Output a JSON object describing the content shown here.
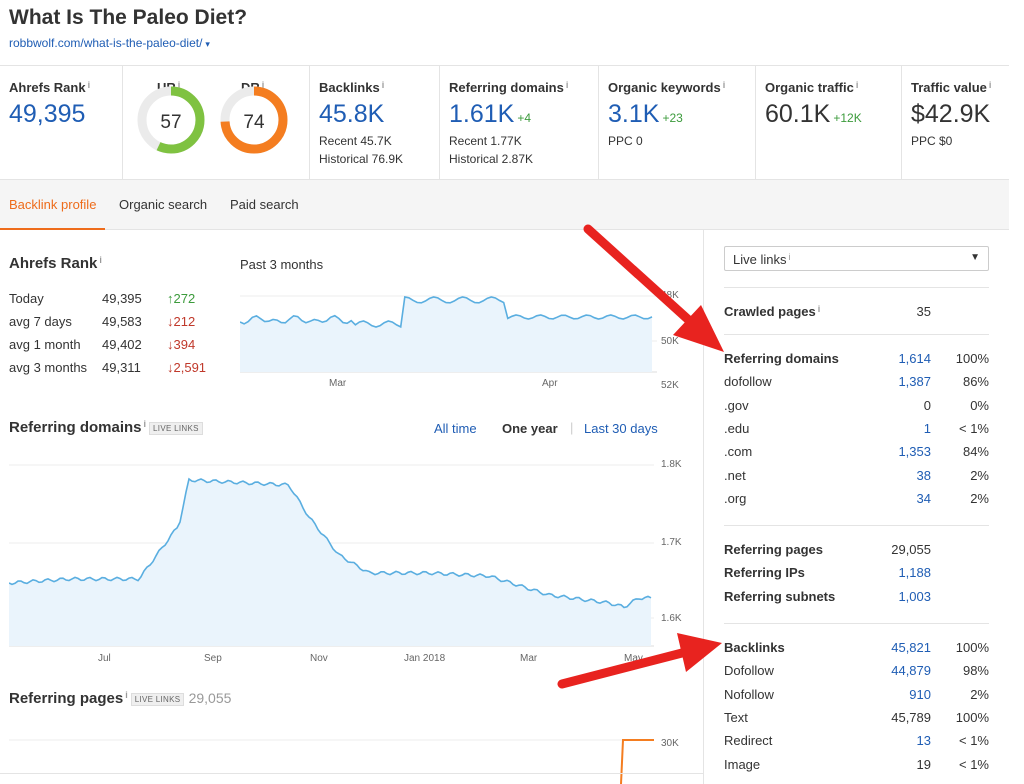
{
  "header": {
    "title": "What Is The Paleo Diet?",
    "url": "robbwolf.com/what-is-the-paleo-diet/",
    "url_caret": "▾"
  },
  "metrics": {
    "ahrefs_rank": {
      "label": "Ahrefs Rank",
      "info": "i",
      "value": "49,395"
    },
    "ur": {
      "label": "UR",
      "info": "i",
      "value": "57",
      "level": 0.57,
      "color": "#7fc241"
    },
    "dr": {
      "label": "DR",
      "info": "i",
      "value": "74",
      "level": 0.74,
      "color": "#f47d20"
    },
    "backlinks": {
      "label": "Backlinks",
      "info": "i",
      "value": "45.8K",
      "recent": "Recent 45.7K",
      "historical": "Historical 76.9K"
    },
    "referring_domains": {
      "label": "Referring domains",
      "info": "i",
      "value": "1.61K",
      "delta": "+4",
      "recent": "Recent 1.77K",
      "historical": "Historical 2.87K"
    },
    "organic_keywords": {
      "label": "Organic keywords",
      "info": "i",
      "value": "3.1K",
      "delta": "+23",
      "ppc": "PPC 0"
    },
    "organic_traffic": {
      "label": "Organic traffic",
      "info": "i",
      "value": "60.1K",
      "delta": "+12K"
    },
    "traffic_value": {
      "label": "Traffic value",
      "info": "i",
      "value": "$42.9K",
      "ppc": "PPC $0"
    }
  },
  "tabs": [
    {
      "label": "Backlink profile",
      "active": true
    },
    {
      "label": "Organic search",
      "active": false
    },
    {
      "label": "Paid search",
      "active": false
    }
  ],
  "ahrefs_rank_section": {
    "title": "Ahrefs Rank",
    "info": "i",
    "period_label": "Past 3 months",
    "rows": [
      {
        "label": "Today",
        "value": "49,395",
        "delta": "↑272",
        "dir": "up"
      },
      {
        "label": "avg 7 days",
        "value": "49,583",
        "delta": "↓212",
        "dir": "down"
      },
      {
        "label": "avg 1 month",
        "value": "49,402",
        "delta": "↓394",
        "dir": "down"
      },
      {
        "label": "avg 3 months",
        "value": "49,311",
        "delta": "↓2,591",
        "dir": "down"
      }
    ],
    "chart": {
      "y_ticks": [
        "48K",
        "50K",
        "52K"
      ],
      "x_ticks": [
        "Mar",
        "Apr"
      ],
      "line_color": "#5aaee0",
      "fill_color": "#eaf4fc"
    }
  },
  "referring_domains_section": {
    "title": "Referring domains",
    "info": "i",
    "badge": "LIVE LINKS",
    "ranges": [
      {
        "label": "All time",
        "selected": false
      },
      {
        "label": "One year",
        "selected": true
      },
      {
        "label": "Last 30 days",
        "selected": false
      }
    ],
    "range_separator": "|",
    "chart": {
      "y_ticks": [
        "1.8K",
        "1.7K",
        "1.6K"
      ],
      "x_ticks": [
        "Jul",
        "Sep",
        "Nov",
        "Jan 2018",
        "Mar",
        "May"
      ],
      "line_color": "#5aaee0",
      "fill_color": "#eaf4fc"
    }
  },
  "referring_pages_section": {
    "title": "Referring pages",
    "info": "i",
    "badge": "LIVE LINKS",
    "value": "29,055",
    "y_tick": "30K",
    "line_color": "#f47d20"
  },
  "right_panel": {
    "select_label": "Live links",
    "select_info": "i",
    "select_arrow": "▼",
    "crawled": {
      "label": "Crawled pages",
      "info": "i",
      "value": "35"
    },
    "domains": [
      {
        "label": "Referring domains",
        "value": "1,614",
        "pct": "100%",
        "bold": true,
        "blue": true
      },
      {
        "label": "dofollow",
        "value": "1,387",
        "pct": "86%",
        "bold": false,
        "blue": true
      },
      {
        "label": ".gov",
        "value": "0",
        "pct": "0%",
        "bold": false,
        "blue": false
      },
      {
        "label": ".edu",
        "value": "1",
        "pct": "< 1%",
        "bold": false,
        "blue": true
      },
      {
        "label": ".com",
        "value": "1,353",
        "pct": "84%",
        "bold": false,
        "blue": true
      },
      {
        "label": ".net",
        "value": "38",
        "pct": "2%",
        "bold": false,
        "blue": true
      },
      {
        "label": ".org",
        "value": "34",
        "pct": "2%",
        "bold": false,
        "blue": true
      }
    ],
    "refs": [
      {
        "label": "Referring pages",
        "value": "29,055",
        "blue": false
      },
      {
        "label": "Referring IPs",
        "value": "1,188",
        "blue": true
      },
      {
        "label": "Referring subnets",
        "value": "1,003",
        "blue": true
      }
    ],
    "backlinks": [
      {
        "label": "Backlinks",
        "value": "45,821",
        "pct": "100%",
        "bold": true,
        "blue": true
      },
      {
        "label": "Dofollow",
        "value": "44,879",
        "pct": "98%",
        "bold": false,
        "blue": true
      },
      {
        "label": "Nofollow",
        "value": "910",
        "pct": "2%",
        "bold": false,
        "blue": true
      },
      {
        "label": "Text",
        "value": "45,789",
        "pct": "100%",
        "bold": false,
        "blue": false
      },
      {
        "label": "Redirect",
        "value": "13",
        "pct": "< 1%",
        "bold": false,
        "blue": true
      },
      {
        "label": "Image",
        "value": "19",
        "pct": "< 1%",
        "bold": false,
        "blue": false
      }
    ]
  },
  "annotation": {
    "arrow_color": "#e8231f"
  }
}
